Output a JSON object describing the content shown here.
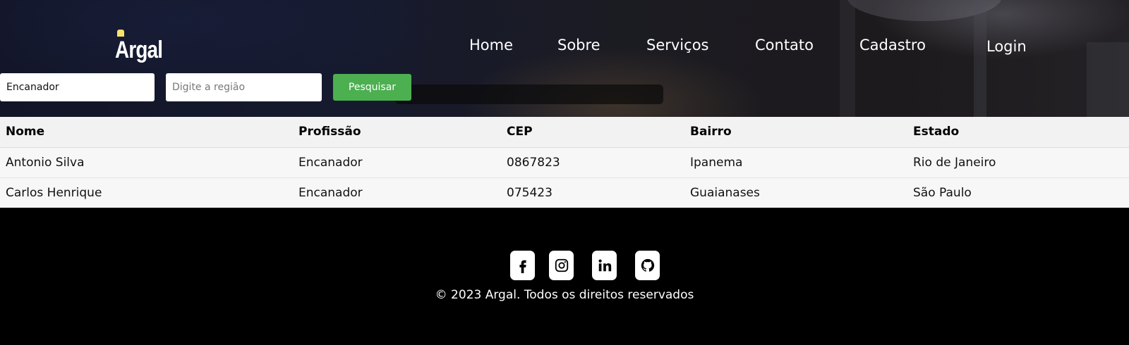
{
  "brand": {
    "name": "Argal"
  },
  "nav": {
    "items": [
      "Home",
      "Sobre",
      "Serviços",
      "Contato",
      "Cadastro"
    ],
    "login": "Login"
  },
  "search": {
    "profession_value": "Encanador",
    "region_placeholder": "Digite a região",
    "button_label": "Pesquisar"
  },
  "table": {
    "headers": [
      "Nome",
      "Profissão",
      "CEP",
      "Bairro",
      "Estado"
    ],
    "rows": [
      [
        "Antonio Silva",
        "Encanador",
        "0867823",
        "Ipanema",
        "Rio de Janeiro"
      ],
      [
        "Carlos Henrique",
        "Encanador",
        "075423",
        "Guaianases",
        "São Paulo"
      ]
    ]
  },
  "footer": {
    "social": [
      "facebook-icon",
      "instagram-icon",
      "linkedin-icon",
      "github-icon"
    ],
    "copyright": "© 2023 Argal. Todos os direitos reservados"
  },
  "colors": {
    "search_button": "#4caf50",
    "footer_bg": "#000000",
    "logo_accent": "#f6e36a"
  }
}
